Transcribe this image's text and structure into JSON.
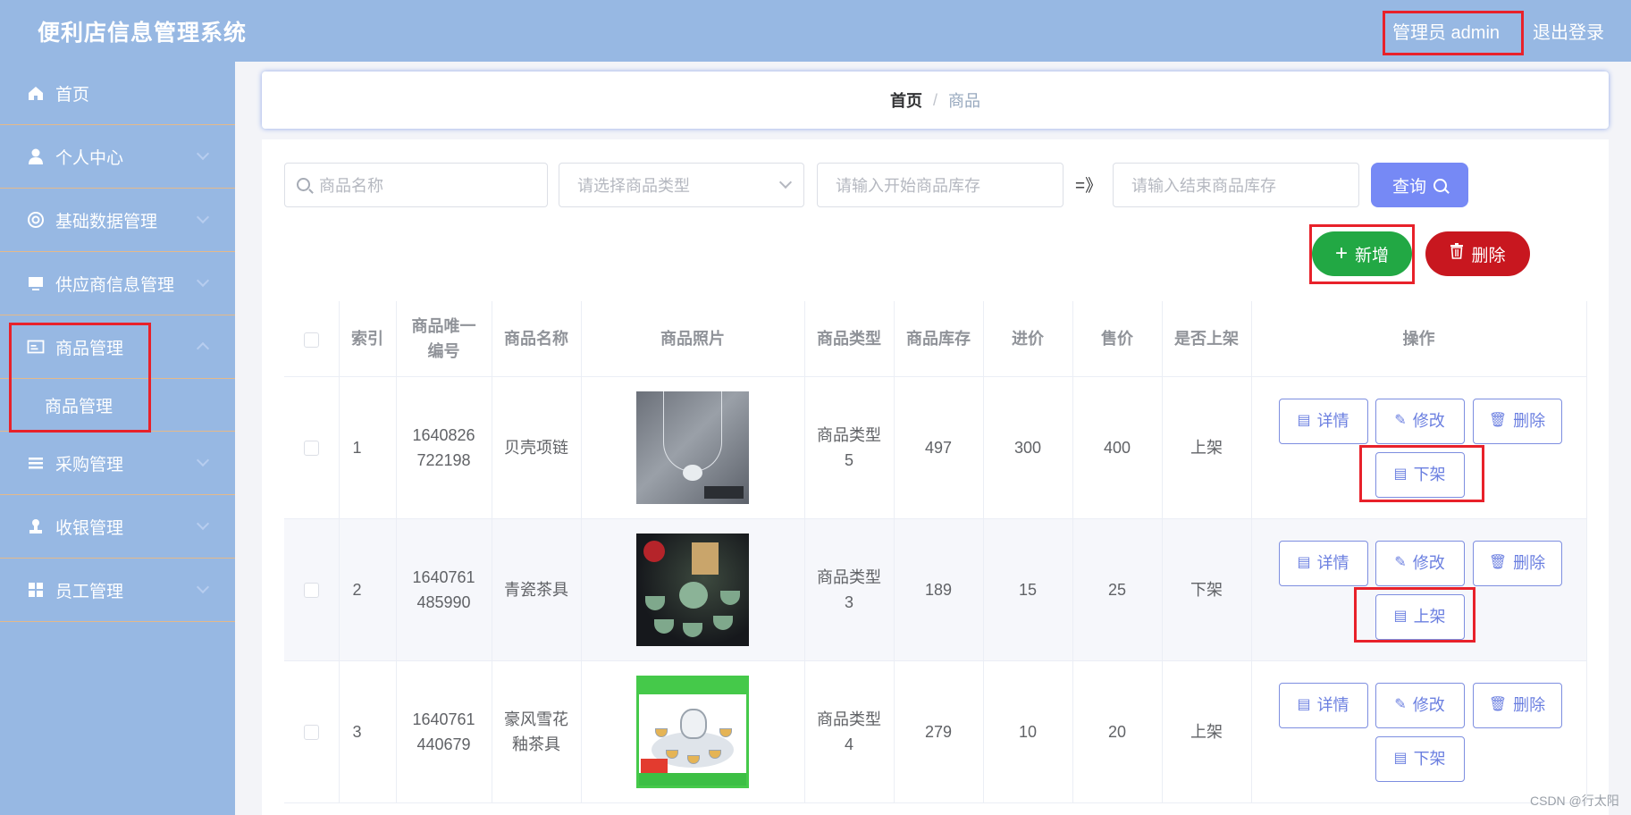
{
  "header": {
    "app_title": "便利店信息管理系统",
    "user_label": "管理员 admin",
    "logout_label": "退出登录"
  },
  "sidebar": {
    "items": [
      {
        "label": "首页",
        "icon": "home-icon"
      },
      {
        "label": "个人中心",
        "icon": "user-icon"
      },
      {
        "label": "基础数据管理",
        "icon": "at-icon"
      },
      {
        "label": "供应商信息管理",
        "icon": "monitor-icon"
      },
      {
        "label": "商品管理",
        "icon": "card-icon"
      },
      {
        "label": "采购管理",
        "icon": "list-icon"
      },
      {
        "label": "收银管理",
        "icon": "stamp-icon"
      },
      {
        "label": "员工管理",
        "icon": "grid-icon"
      }
    ],
    "submenu_label": "商品管理"
  },
  "breadcrumb": {
    "home": "首页",
    "separator": "/",
    "current": "商品"
  },
  "filters": {
    "name_placeholder": "商品名称",
    "type_placeholder": "请选择商品类型",
    "start_stock_placeholder": "请输入开始商品库存",
    "range_separator": "=》",
    "end_stock_placeholder": "请输入结束商品库存",
    "query_label": "查询"
  },
  "actions": {
    "add_label": "新增",
    "delete_label": "删除"
  },
  "table": {
    "headers": [
      "索引",
      "商品唯一编号",
      "商品名称",
      "商品照片",
      "商品类型",
      "商品库存",
      "进价",
      "售价",
      "是否上架",
      "操作"
    ],
    "rows": [
      {
        "index": "1",
        "code": "1640826722198",
        "name": "贝壳项链",
        "type": "商品类型5",
        "stock": "497",
        "cost": "300",
        "price": "400",
        "status": "上架",
        "toggle_label": "下架"
      },
      {
        "index": "2",
        "code": "1640761485990",
        "name": "青瓷茶具",
        "type": "商品类型3",
        "stock": "189",
        "cost": "15",
        "price": "25",
        "status": "下架",
        "toggle_label": "上架"
      },
      {
        "index": "3",
        "code": "1640761440679",
        "name": "豪风雪花釉茶具",
        "type": "商品类型4",
        "stock": "279",
        "cost": "10",
        "price": "20",
        "status": "上架",
        "toggle_label": "下架"
      }
    ],
    "op_labels": {
      "detail": "详情",
      "edit": "修改",
      "delete": "删除"
    }
  },
  "watermark": "CSDN @行太阳",
  "colors": {
    "header_bg": "#97b8e3",
    "primary": "#7689f5",
    "success": "#22a844",
    "danger": "#c8171f",
    "highlight_box": "#e8212a"
  }
}
